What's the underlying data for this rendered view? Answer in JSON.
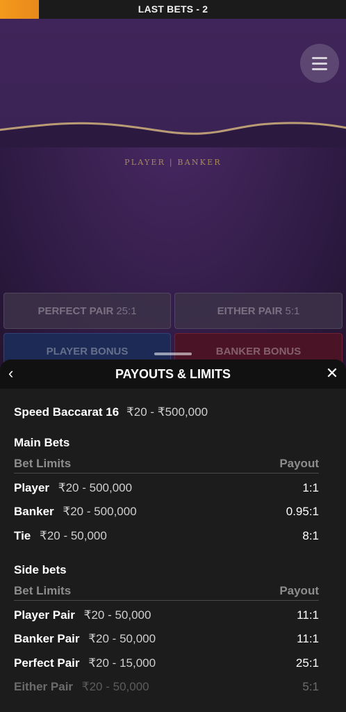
{
  "topbar": {
    "title": "LAST BETS - 2",
    "accent_color": "#f39a1c"
  },
  "table": {
    "label": "PLAYER | BANKER",
    "menu_icon": "hamburger-menu-icon",
    "bets": {
      "perfect_pair": {
        "label": "PERFECT PAIR",
        "odds": "25:1"
      },
      "either_pair": {
        "label": "EITHER PAIR",
        "odds": "5:1"
      },
      "player_bonus": {
        "label": "PLAYER BONUS"
      },
      "banker_bonus": {
        "label": "BANKER BONUS"
      }
    }
  },
  "panel": {
    "title": "PAYOUTS & LIMITS",
    "back_icon": "chevron-left-icon",
    "close_icon": "close-icon",
    "game": {
      "name": "Speed Baccarat 16",
      "limits": "₹20 - ₹500,000"
    },
    "main_bets": {
      "title": "Main Bets",
      "col_limits": "Bet Limits",
      "col_payout": "Payout",
      "rows": [
        {
          "name": "Player",
          "limits": "₹20 - 500,000",
          "payout": "1:1"
        },
        {
          "name": "Banker",
          "limits": "₹20 - 500,000",
          "payout": "0.95:1"
        },
        {
          "name": "Tie",
          "limits": "₹20 - 50,000",
          "payout": "8:1"
        }
      ]
    },
    "side_bets": {
      "title": "Side bets",
      "col_limits": "Bet Limits",
      "col_payout": "Payout",
      "rows": [
        {
          "name": "Player Pair",
          "limits": "₹20 - 50,000",
          "payout": "11:1"
        },
        {
          "name": "Banker Pair",
          "limits": "₹20 - 50,000",
          "payout": "11:1"
        },
        {
          "name": "Perfect Pair",
          "limits": "₹20 - 15,000",
          "payout": "25:1"
        },
        {
          "name": "Either Pair",
          "limits": "₹20 - 50,000",
          "payout": "5:1"
        }
      ]
    }
  }
}
